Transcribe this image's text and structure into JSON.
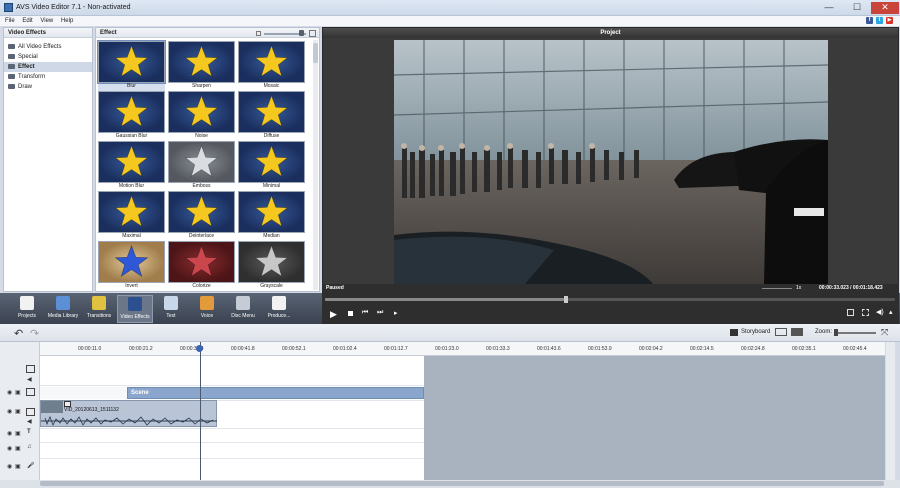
{
  "window": {
    "title": "AVS Video Editor 7.1 - Non-activated",
    "minimize": "—",
    "maximize": "☐",
    "close": "✕"
  },
  "menu": [
    "File",
    "Edit",
    "View",
    "Help"
  ],
  "social": {
    "facebook": "f",
    "twitter": "t",
    "youtube": "▶"
  },
  "left_panel": {
    "header": "Video Effects",
    "items": [
      "All Video Effects",
      "Special",
      "Effect",
      "Transform",
      "Draw"
    ],
    "selected": "Effect"
  },
  "effects_panel": {
    "header": "Effect",
    "tiles": [
      {
        "label": "Blur",
        "style": "blue"
      },
      {
        "label": "Sharpen",
        "style": "blue"
      },
      {
        "label": "Mosaic",
        "style": "blue"
      },
      {
        "label": "Gaussian Blur",
        "style": "blue"
      },
      {
        "label": "Noise",
        "style": "blue"
      },
      {
        "label": "Diffuse",
        "style": "blue"
      },
      {
        "label": "Motion Blur",
        "style": "blue"
      },
      {
        "label": "Emboss",
        "style": "gray"
      },
      {
        "label": "Minimal",
        "style": "blue"
      },
      {
        "label": "Maximal",
        "style": "blue"
      },
      {
        "label": "Deinterlace",
        "style": "blue"
      },
      {
        "label": "Median",
        "style": "blue"
      },
      {
        "label": "Invert",
        "style": "invert"
      },
      {
        "label": "Colorize",
        "style": "red"
      },
      {
        "label": "Grayscale",
        "style": "grayscale"
      }
    ],
    "selected": "Blur"
  },
  "project": {
    "header": "Project",
    "status": "Paused",
    "speed": "1x",
    "time": "00:00:33.023 / 00:01:18.423",
    "progress": 0.42
  },
  "toolbar": [
    {
      "label": "Projects",
      "icon": "film-icon",
      "color": "#f2f2f2"
    },
    {
      "label": "Media Library",
      "icon": "library-icon",
      "color": "#5b8fd6"
    },
    {
      "label": "Transitions",
      "icon": "transition-icon",
      "color": "#e0c240"
    },
    {
      "label": "Video Effects",
      "icon": "star-icon",
      "color": "#2b4f8f"
    },
    {
      "label": "Text",
      "icon": "text-icon",
      "color": "#c9d7ea"
    },
    {
      "label": "Voice",
      "icon": "microphone-icon",
      "color": "#e39a3a"
    },
    {
      "label": "Disc Menu",
      "icon": "disc-icon",
      "color": "#c6ccd6"
    },
    {
      "label": "Produce...",
      "icon": "produce-icon",
      "color": "#f2f2f2"
    }
  ],
  "timeline": {
    "storyboard": "Storyboard",
    "zoom": "Zoom:",
    "ruler": [
      "00:00:11.0",
      "00:00:21.2",
      "00:00:31.4",
      "00:00:41.8",
      "00:00:52.1",
      "00:01:02.4",
      "00:01:12.7",
      "00:01:23.0",
      "00:01:33.3",
      "00:01:43.6",
      "00:01:53.9",
      "00:02:04.2",
      "00:02:14.5",
      "00:02:24.8",
      "00:02:35.1",
      "00:02:45.4"
    ],
    "scene_label": "Scene",
    "clip_label": "VID_20120613_1511132"
  }
}
